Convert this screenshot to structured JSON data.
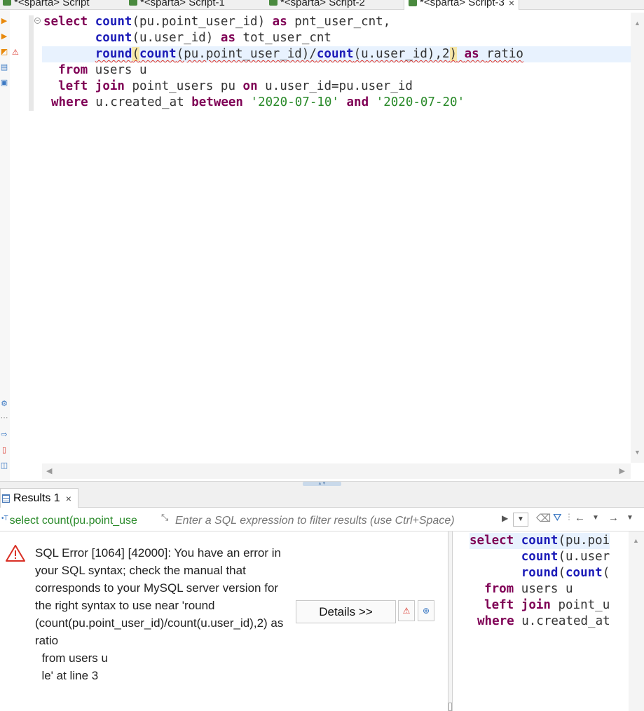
{
  "tabs": [
    {
      "label": "*<sparta> Script"
    },
    {
      "label": "*<sparta> Script-1"
    },
    {
      "label": "*<sparta> Script-2"
    },
    {
      "label": "*<sparta> Script-3"
    }
  ],
  "editor": {
    "lines": [
      [
        "select",
        "count",
        "(pu.point_user_id)",
        "as",
        "pnt_user_cnt,"
      ],
      [
        "count",
        "(u.user_id)",
        "as",
        "tot_user_cnt"
      ],
      [
        "round",
        "(",
        "count",
        "(pu.point_user_id)/",
        "count",
        "(u.user_id),2",
        ")",
        "as",
        "ratio"
      ],
      [
        "from",
        "users u"
      ],
      [
        "left",
        "join",
        "point_users pu",
        "on",
        "u.user_id=pu.user_id"
      ],
      [
        "where",
        "u.created_at",
        "between",
        "'2020-07-10'",
        "and",
        "'2020-07-20'"
      ]
    ]
  },
  "results": {
    "tab_label": "Results 1",
    "query_label": "select count(pu.point_use",
    "filter_placeholder": "Enter a SQL expression to filter results (use Ctrl+Space)",
    "error_message": "SQL Error [1064] [42000]: You have an error in your SQL syntax; check the manual that corresponds to your MySQL server version for the right syntax to use near 'round (count(pu.point_user_id)/count(u.user_id),2) as ratio\n  from users u\n  le' at line 3",
    "details_label": "Details >>"
  },
  "preview": {
    "lines": [
      [
        "select",
        "count",
        "(pu.poi"
      ],
      [
        "count",
        "(u.user"
      ],
      [
        "round",
        "(",
        "count",
        "("
      ],
      [
        "from",
        "users u"
      ],
      [
        "left",
        "join",
        "point_u"
      ],
      [
        "where",
        "u.created_at"
      ]
    ]
  },
  "colors": {
    "keyword": "#7f0055",
    "function": "#1c1cb8",
    "string": "#2a8a2a",
    "current_line": "#e8f2fe",
    "error": "#d93025"
  }
}
